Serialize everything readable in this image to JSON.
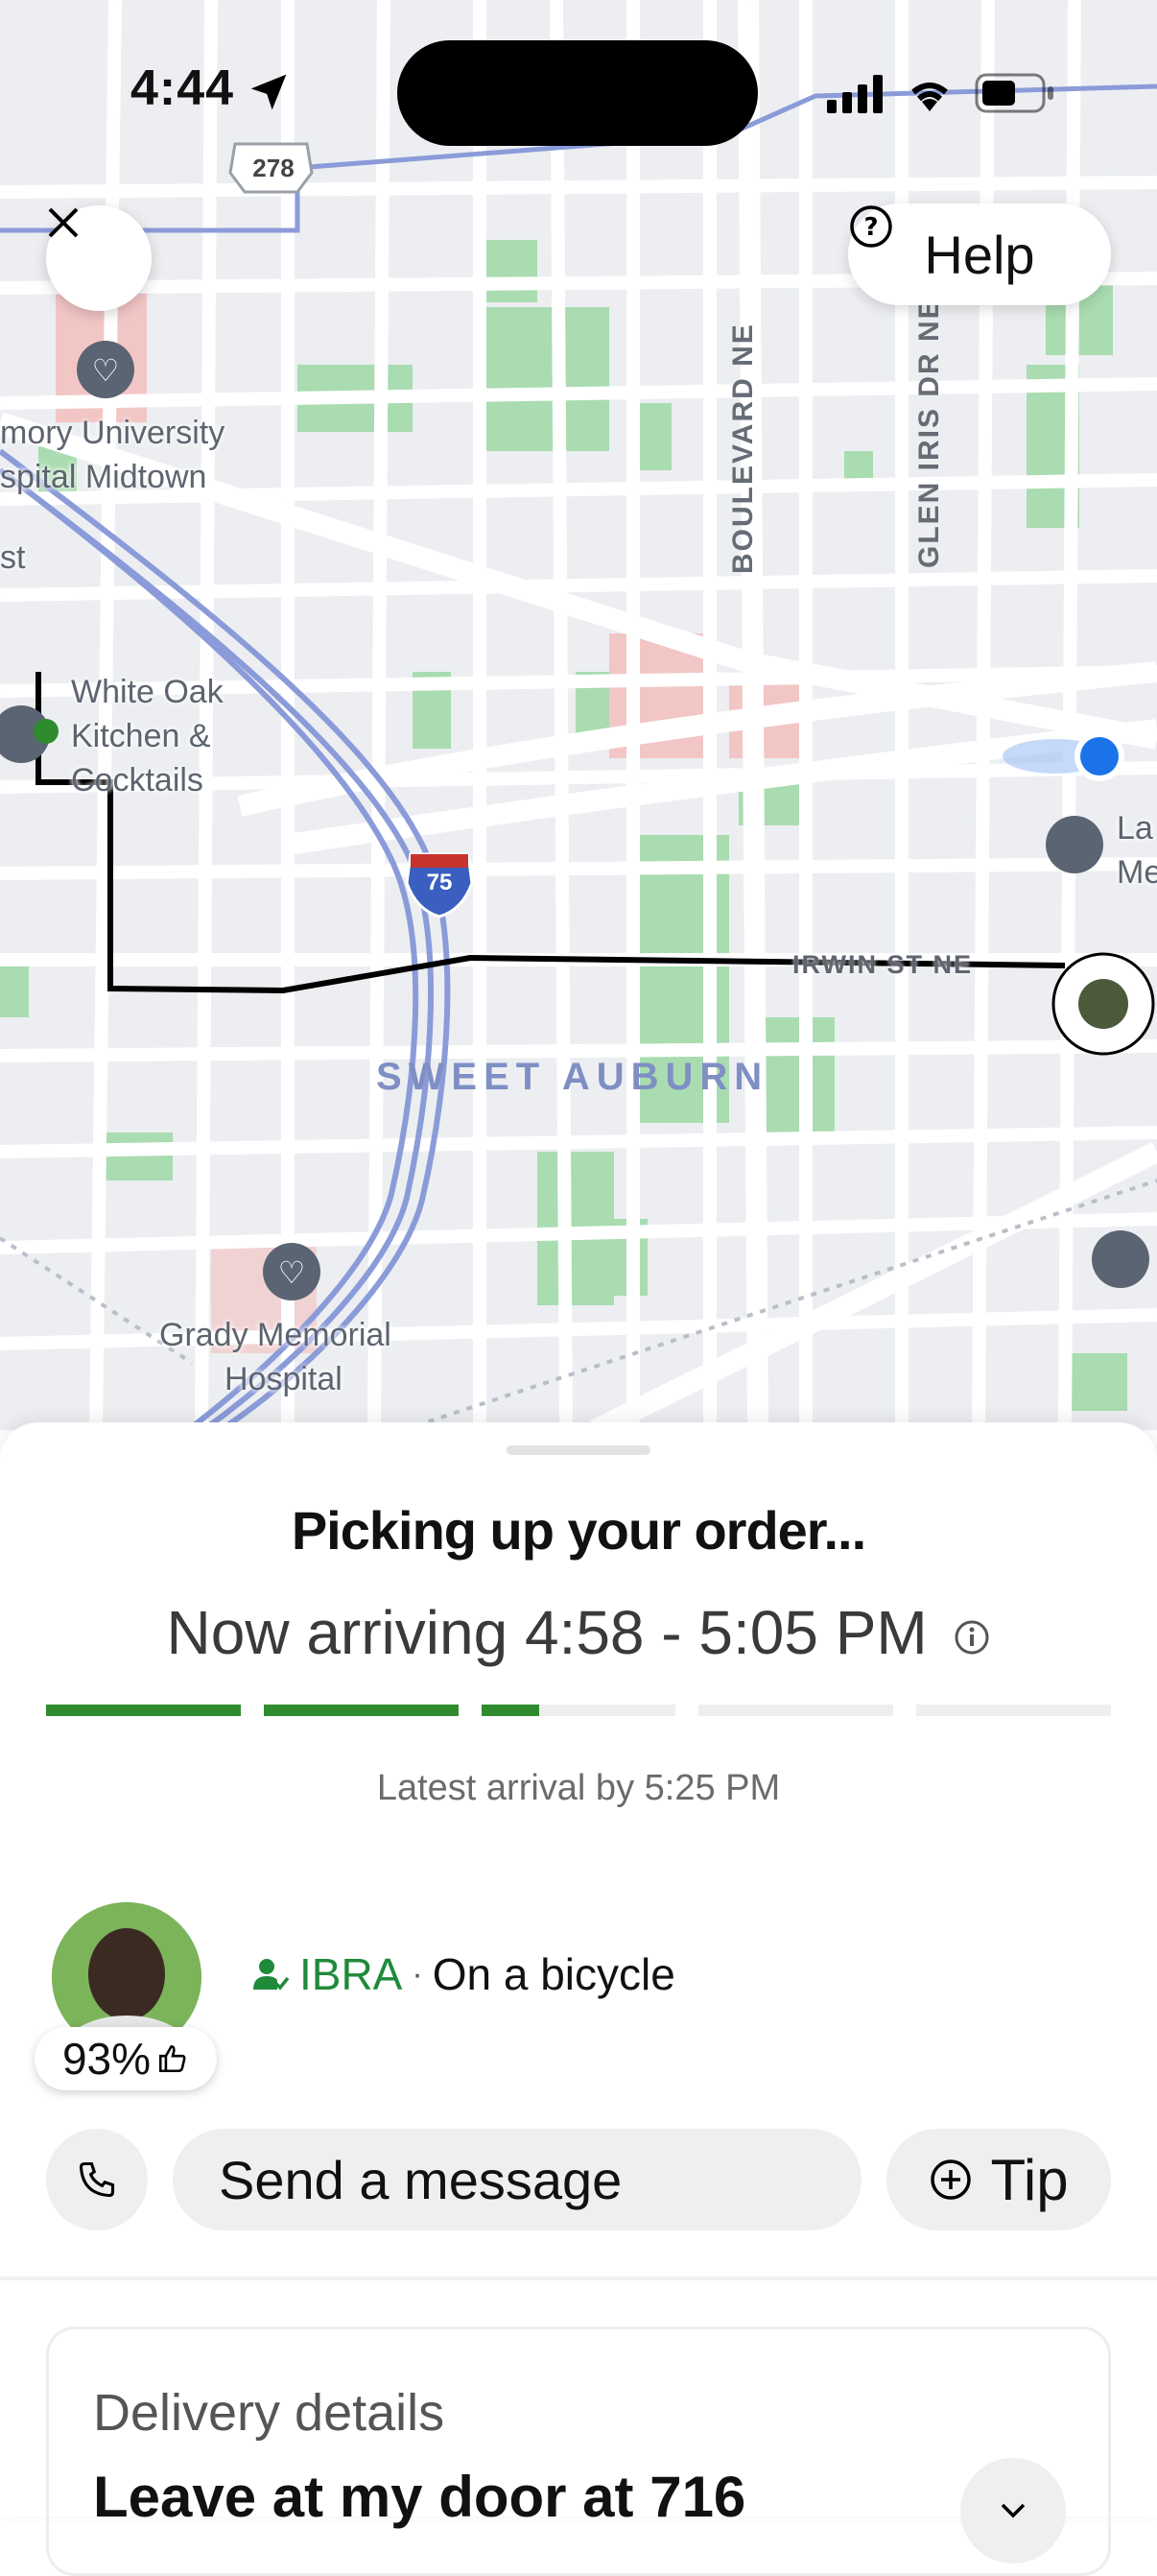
{
  "status_bar": {
    "time": "4:44"
  },
  "map": {
    "labels": {
      "emory": "mory University",
      "emory2": "spital Midtown",
      "st": "st",
      "restaurant1": "White Oak",
      "restaurant2": "Kitchen &",
      "restaurant3": "Cocktails",
      "grady1": "Grady Memorial",
      "grady2": "Hospital",
      "right1": "La",
      "right2": "Me"
    },
    "streets": {
      "boulevard": "BOULEVARD NE",
      "glen_iris": "GLEN IRIS DR NE",
      "irwin": "IRWIN ST NE"
    },
    "neighborhood": "SWEET AUBURN",
    "shields": {
      "us_route": "278",
      "interstate": "75"
    },
    "help_label": "Help"
  },
  "sheet": {
    "title": "Picking up your order...",
    "eta": "Now arriving 4:58 - 5:05 PM",
    "progress": [
      1,
      1,
      0.3,
      0,
      0
    ],
    "latest": "Latest arrival by 5:25 PM",
    "courier": {
      "name": "IBRA",
      "separator": "·",
      "mode": "On a bicycle",
      "rating": "93%"
    },
    "actions": {
      "message": "Send a message",
      "tip": "Tip"
    },
    "delivery": {
      "label": "Delivery details",
      "value": "Leave at my door at 716"
    }
  },
  "colors": {
    "green": "#2e8b2e",
    "park": "#a9dcb0",
    "route_blue": "#8b9bd9",
    "location_blue": "#1a73e8"
  }
}
